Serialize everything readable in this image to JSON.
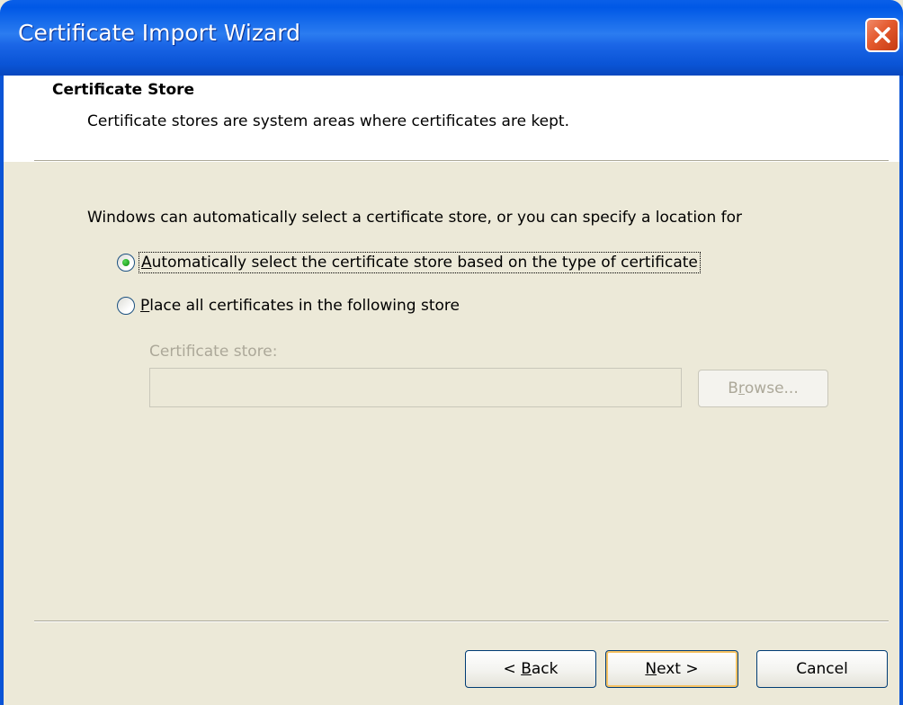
{
  "window": {
    "title": "Certificate Import Wizard"
  },
  "header": {
    "title": "Certificate Store",
    "subtitle": "Certificate stores are system areas where certificates are kept."
  },
  "main": {
    "instruction": "Windows can automatically select a certificate store, or you can specify a location for",
    "options": [
      {
        "mnemonic": "A",
        "rest": "utomatically select the certificate store based on the type of certificate",
        "selected": true
      },
      {
        "mnemonic": "P",
        "rest": "lace all certificates in the following store",
        "selected": false
      }
    ],
    "store_label": "Certificate store:",
    "store_value": "",
    "browse": {
      "pre": "B",
      "mnemonic": "r",
      "post": "owse...",
      "enabled": false
    }
  },
  "footer": {
    "back": {
      "pre": "< ",
      "mnemonic": "B",
      "post": "ack"
    },
    "next": {
      "pre": "",
      "mnemonic": "N",
      "post": "ext >"
    },
    "cancel": {
      "label": "Cancel"
    }
  },
  "colors": {
    "titlebar": "#0a54d6",
    "dialog_bg": "#ece9d8",
    "radio_selected": "#21a121",
    "disabled_text": "#aca899"
  },
  "icons": {
    "close": "close-icon"
  }
}
